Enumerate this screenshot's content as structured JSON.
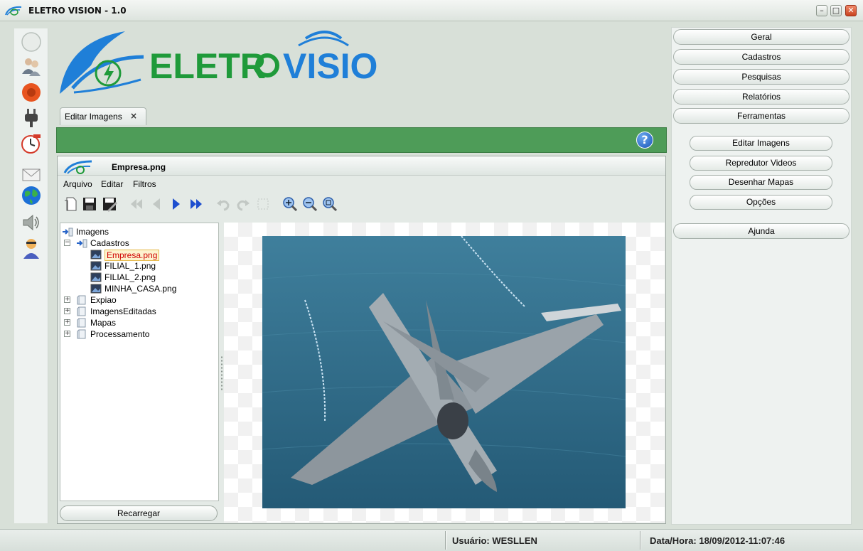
{
  "window": {
    "title": "ELETRO VISION - 1.0",
    "minimize_glyph": "–",
    "maximize_glyph": "□",
    "close_glyph": "✕"
  },
  "brand": {
    "wordmark": "ELETRO VISION",
    "colors": {
      "green": "#1f9a3a",
      "blue": "#1f7fd8"
    }
  },
  "left_strip_icons": [
    "blank-circle-icon",
    "users-icon",
    "record-icon",
    "plug-icon",
    "clock-icon",
    "mail-icon",
    "globe-icon",
    "speaker-icon",
    "user-icon"
  ],
  "tab": {
    "label": "Editar Imagens",
    "close": "×"
  },
  "help_glyph": "?",
  "editor": {
    "file_title": "Empresa.png",
    "menu": [
      "Arquivo",
      "Editar",
      "Filtros"
    ],
    "toolbar_icons": [
      "new-icon",
      "save-icon",
      "save-as-icon",
      "first-icon",
      "prev-icon",
      "next-icon",
      "last-icon",
      "undo-icon",
      "redo-icon",
      "select-icon",
      "zoom-in-icon",
      "zoom-out-icon",
      "zoom-fit-icon"
    ]
  },
  "tree": {
    "root": "Imagens",
    "folder": "Cadastros",
    "files": [
      "Empresa.png",
      "FILIAL_1.png",
      "FILIAL_2.png",
      "MINHA_CASA.png"
    ],
    "selected": "Empresa.png",
    "other_folders": [
      "Expiao",
      "ImagensEditadas",
      "Mapas",
      "Processamento"
    ]
  },
  "reload_label": "Recarregar",
  "nav": {
    "main": [
      "Geral",
      "Cadastros",
      "Pesquisas",
      "Relatórios",
      "Ferramentas"
    ],
    "sub": [
      "Editar Imagens",
      "Repredutor Videos",
      "Desenhar Mapas",
      "Opções"
    ],
    "help": "Ajunda"
  },
  "status": {
    "user": "Usuário: WESLLEN",
    "datetime": "Data/Hora: 18/09/2012-11:07:46"
  }
}
